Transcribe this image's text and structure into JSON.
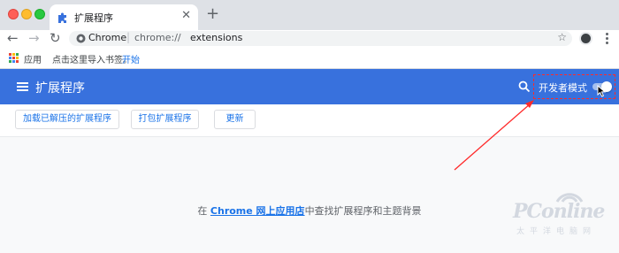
{
  "window": {
    "tab_title": "扩展程序",
    "tab_close": "✕",
    "new_tab": "+"
  },
  "toolbar": {
    "back": "←",
    "forward": "→",
    "reload": "↻",
    "site_label": "Chrome",
    "url_scheme": "chrome://",
    "url_host": "extensions",
    "bookmark_star": "☆"
  },
  "bookmarks": {
    "apps_label": "应用",
    "hint": "点击这里导入书签。",
    "start": "开始"
  },
  "header": {
    "title": "扩展程序",
    "developer_mode_label": "开发者模式",
    "developer_mode_enabled": true,
    "accent_color": "#3871dd"
  },
  "actions": {
    "load_unpacked": "加载已解压的扩展程序",
    "pack": "打包扩展程序",
    "update": "更新"
  },
  "main": {
    "prefix": "在 ",
    "store_link": "Chrome 网上应用店",
    "suffix": "中查找扩展程序和主题背景"
  },
  "watermark": {
    "brand": "PConline",
    "sub": "太平洋电脑网"
  }
}
